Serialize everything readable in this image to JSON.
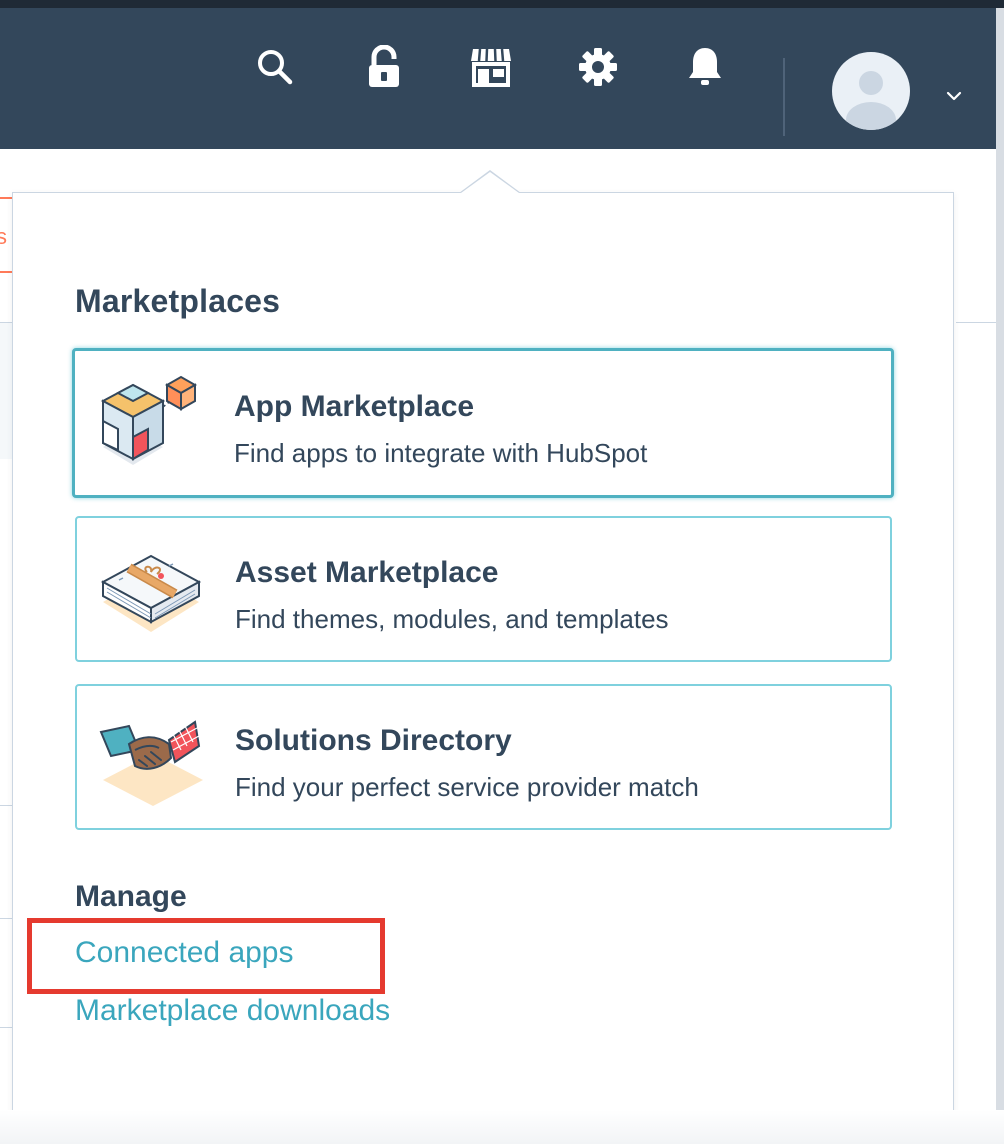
{
  "colors": {
    "navbar_bg": "#33475b",
    "link": "#3aa6bd",
    "card_border": "#7fd1de",
    "highlight": "#e53a2f",
    "background_tab_accent": "#ff7a59"
  },
  "navbar": {
    "icons": [
      "search-icon",
      "unlock-icon",
      "marketplace-store-icon",
      "settings-gear-icon",
      "notifications-bell-icon"
    ],
    "account_menu_icon": "chevron-down-icon"
  },
  "background_page": {
    "tab_fragment": "s"
  },
  "dropdown": {
    "marketplaces_heading": "Marketplaces",
    "cards": [
      {
        "title": "App Marketplace",
        "description": "Find apps to integrate with HubSpot",
        "icon": "app-cubes-illustration",
        "active": true
      },
      {
        "title": "Asset Marketplace",
        "description": "Find themes, modules, and templates",
        "icon": "asset-package-illustration",
        "active": false
      },
      {
        "title": "Solutions Directory",
        "description": "Find your perfect service provider match",
        "icon": "handshake-illustration",
        "active": false
      }
    ],
    "manage_heading": "Manage",
    "manage_links": [
      {
        "label": "Connected apps",
        "highlighted": true
      },
      {
        "label": "Marketplace downloads",
        "highlighted": false
      }
    ]
  }
}
